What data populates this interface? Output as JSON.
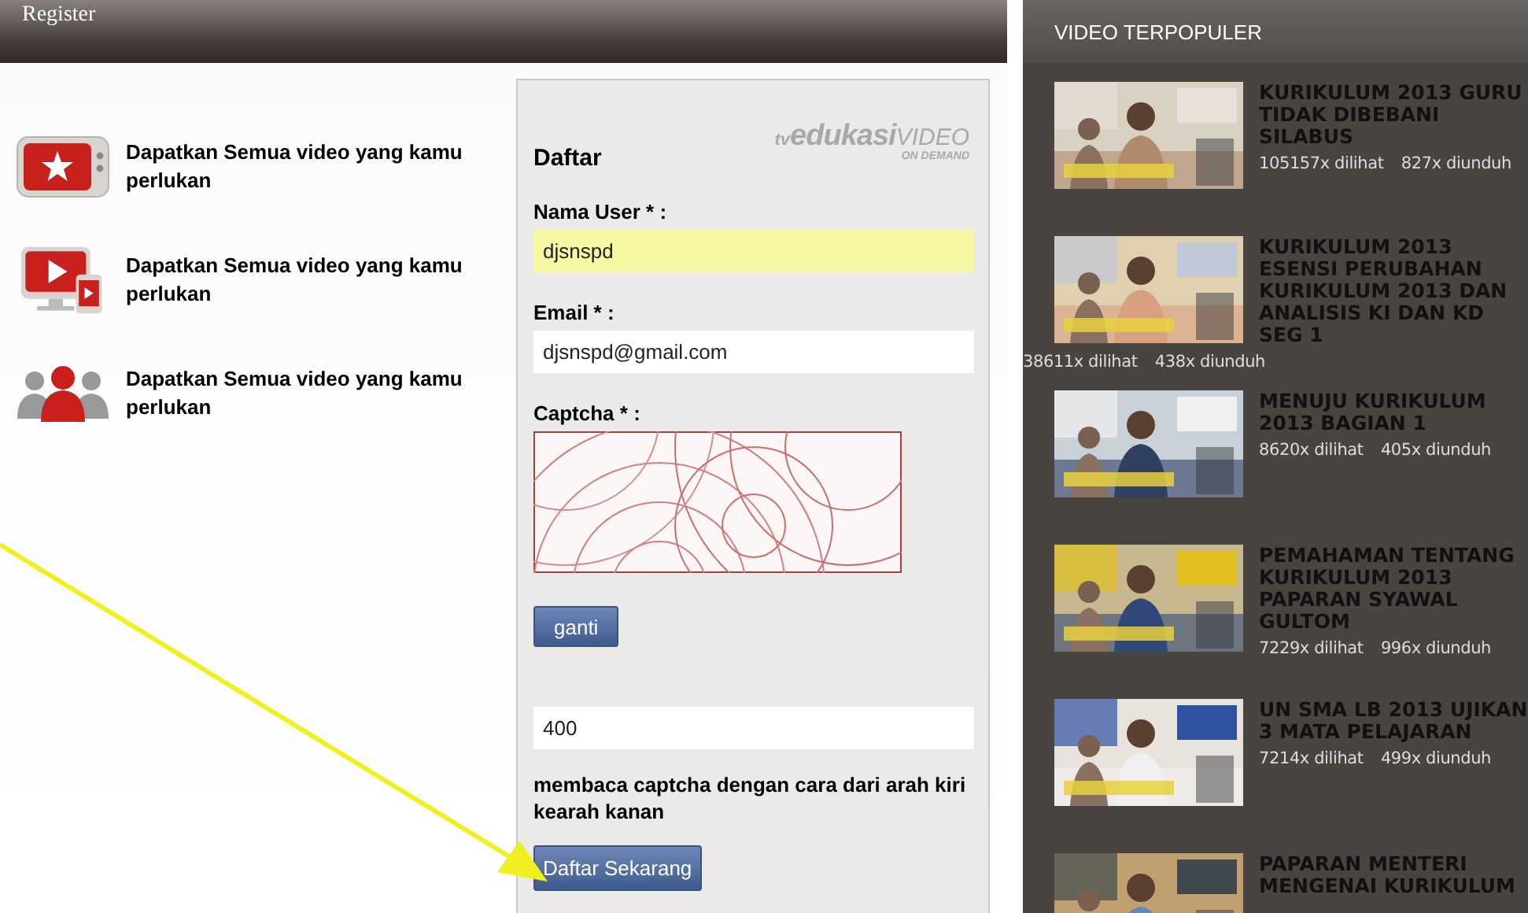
{
  "register_panel": {
    "title": "Register",
    "features": [
      {
        "kind": "tv",
        "text": "Dapatkan Semua video yang kamu perlukan"
      },
      {
        "kind": "devices",
        "text": "Dapatkan Semua video yang kamu perlukan"
      },
      {
        "kind": "people",
        "text": "Dapatkan Semua video yang kamu perlukan"
      }
    ],
    "form": {
      "title": "Daftar",
      "logo": {
        "prefix": "tv",
        "brand": "edukasi",
        "product": "VIDEO",
        "tagline": "ON DEMAND"
      },
      "username": {
        "label": "Nama User * :",
        "value": "djsnspd",
        "highlighted": true
      },
      "email": {
        "label": "Email * :",
        "value": "djsnspd@gmail.com",
        "highlighted": false
      },
      "captcha": {
        "label": "Captcha * :",
        "refresh_button": "ganti",
        "value": "400"
      },
      "note": "membaca captcha dengan cara dari arah kiri kearah kanan",
      "submit_button": "Daftar Sekarang"
    }
  },
  "popular_videos": {
    "title": "VIDEO TERPOPULER",
    "items": [
      {
        "title": "KURIKULUM 2013 GURU TIDAK DIBEBANI SILABUS",
        "views": "105157x dilihat",
        "downloads": "827x diunduh"
      },
      {
        "title": "KURIKULUM 2013 ESENSI PERUBAHAN KURIKULUM 2013 DAN ANALISIS KI DAN KD SEG 1",
        "views": "38611x dilihat",
        "downloads": "438x diunduh"
      },
      {
        "title": "MENUJU KURIKULUM 2013 BAGIAN 1",
        "views": "8620x dilihat",
        "downloads": "405x diunduh"
      },
      {
        "title": "PEMAHAMAN TENTANG KURIKULUM 2013 PAPARAN SYAWAL GULTOM",
        "views": "7229x dilihat",
        "downloads": "996x diunduh"
      },
      {
        "title": "UN SMA LB 2013 UJIKAN 3 MATA PELAJARAN",
        "views": "7214x dilihat",
        "downloads": "499x diunduh"
      },
      {
        "title": "PAPARAN MENTERI MENGENAI KURIKULUM"
      }
    ]
  }
}
